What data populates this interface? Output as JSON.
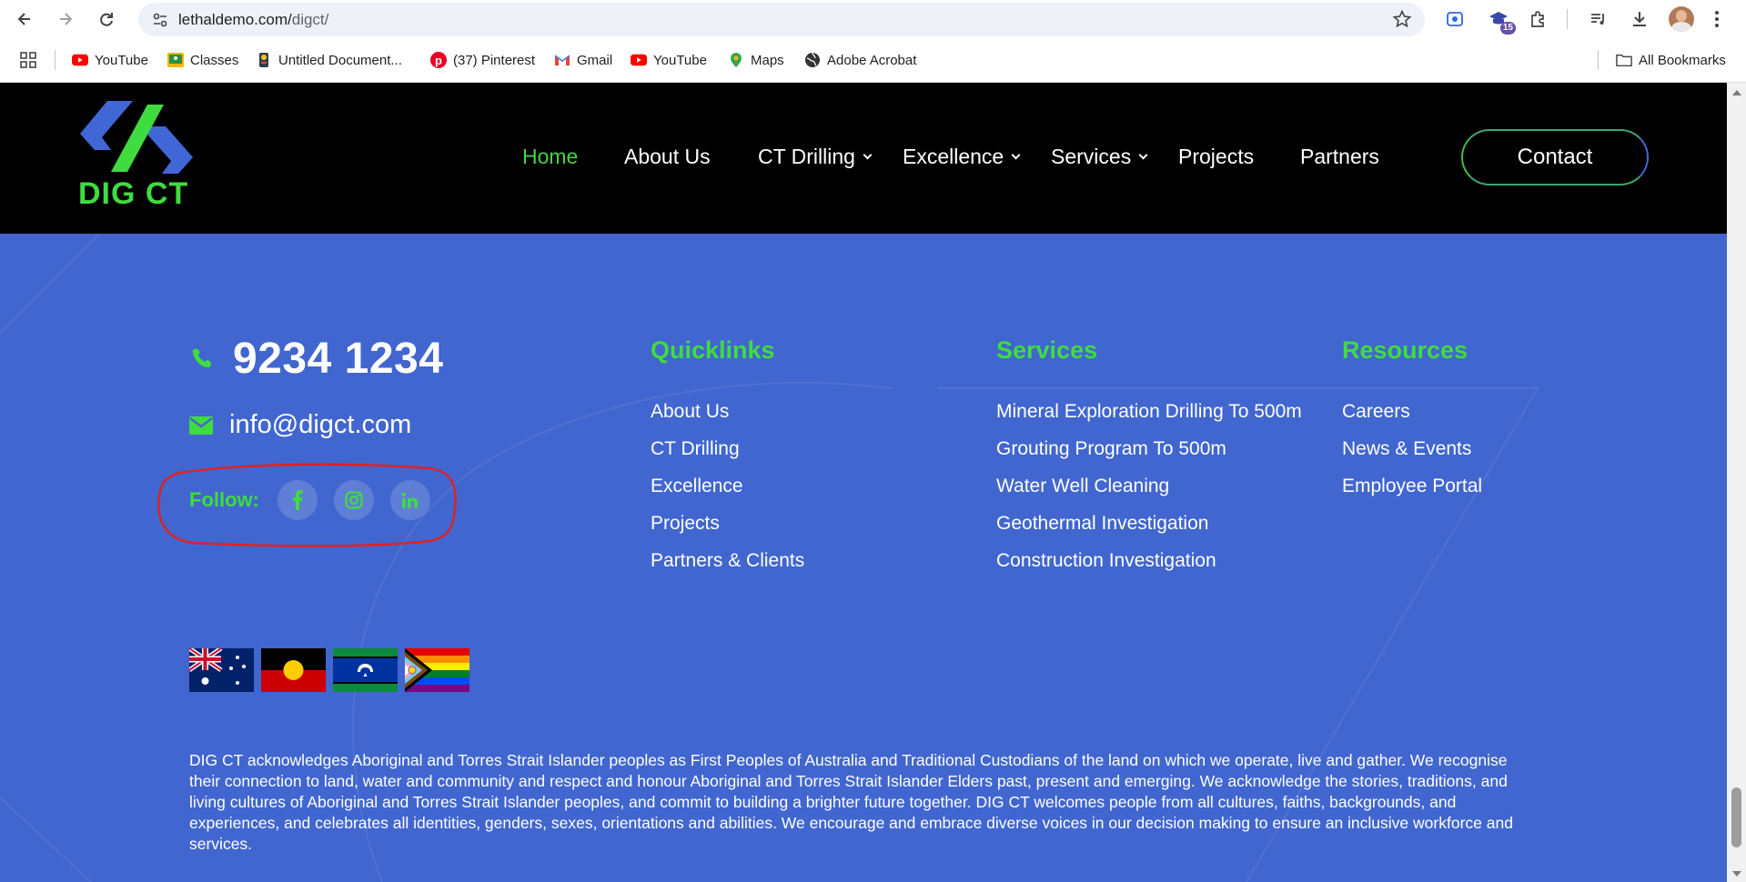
{
  "browser": {
    "url_host": "lethaldemo.com/",
    "url_path": "digct/",
    "extensions_badge": "15",
    "bookmarks": [
      {
        "label": "YouTube",
        "icon": "youtube-icon"
      },
      {
        "label": "Classes",
        "icon": "classroom-icon"
      },
      {
        "label": "Untitled Document...",
        "icon": "document-icon"
      },
      {
        "label": "(37) Pinterest",
        "icon": "pinterest-icon"
      },
      {
        "label": "Gmail",
        "icon": "gmail-icon"
      },
      {
        "label": "YouTube",
        "icon": "youtube-icon"
      },
      {
        "label": "Maps",
        "icon": "maps-icon"
      },
      {
        "label": "Adobe Acrobat",
        "icon": "globe-icon"
      }
    ],
    "all_bookmarks": "All Bookmarks"
  },
  "header": {
    "logo_text": "DIG CT",
    "nav": [
      {
        "label": "Home",
        "active": true,
        "dropdown": false
      },
      {
        "label": "About Us",
        "active": false,
        "dropdown": false
      },
      {
        "label": "CT Drilling",
        "active": false,
        "dropdown": true
      },
      {
        "label": "Excellence",
        "active": false,
        "dropdown": true
      },
      {
        "label": "Services",
        "active": false,
        "dropdown": true
      },
      {
        "label": "Projects",
        "active": false,
        "dropdown": false
      },
      {
        "label": "Partners",
        "active": false,
        "dropdown": false
      }
    ],
    "contact_label": "Contact"
  },
  "footer": {
    "phone": "9234 1234",
    "email": "info@digct.com",
    "follow_label": "Follow:",
    "social": [
      "facebook-icon",
      "instagram-icon",
      "linkedin-icon"
    ],
    "quicklinks": {
      "title": "Quicklinks",
      "links": [
        "About Us",
        "CT Drilling",
        "Excellence",
        "Projects",
        "Partners & Clients"
      ]
    },
    "services": {
      "title": "Services",
      "links": [
        "Mineral Exploration Drilling To 500m",
        "Grouting Program To 500m",
        "Water Well Cleaning",
        "Geothermal Investigation",
        "Construction Investigation"
      ]
    },
    "resources": {
      "title": "Resources",
      "links": [
        "Careers",
        "News & Events",
        "Employee Portal"
      ]
    },
    "flags": [
      "australian-flag",
      "aboriginal-flag",
      "torres-strait-islander-flag",
      "progress-pride-flag"
    ],
    "acknowledgement": "DIG CT acknowledges Aboriginal and Torres Strait Islander peoples as First Peoples of Australia and Traditional Custodians of the land on which we operate, live and gather. We recognise their connection to land, water and community and respect and honour Aboriginal and Torres Strait Islander Elders past, present and emerging. We acknowledge the stories, traditions, and living cultures of Aboriginal and Torres Strait Islander peoples, and commit to building a brighter future together. DIG CT welcomes people from all cultures, faiths, backgrounds, and experiences, and celebrates all identities, genders, sexes, orientations and abilities. We encourage and embrace diverse voices in our decision making to ensure an inclusive workforce and services."
  },
  "colors": {
    "footer_bg": "#4166cf",
    "accent_green": "#3fdc3f",
    "header_bg": "#000000",
    "annotation_red": "#e0201f"
  }
}
